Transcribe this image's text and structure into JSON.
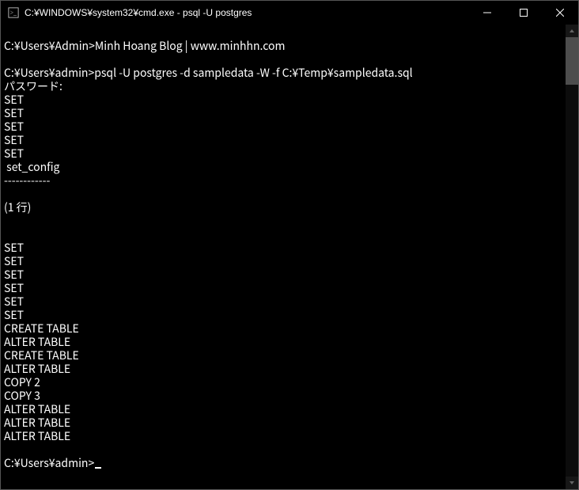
{
  "titlebar": {
    "icon_name": "cmd-icon",
    "text": "C:¥WINDOWS¥system32¥cmd.exe - psql  -U postgres"
  },
  "terminal": {
    "lines": [
      "",
      "C:¥Users¥Admin>Minh Hoang Blog | www.minhhn.com",
      "",
      "C:¥Users¥admin>psql -U postgres -d sampledata -W -f C:¥Temp¥sampledata.sql",
      "パスワード:",
      "SET",
      "SET",
      "SET",
      "SET",
      "SET",
      " set_config",
      "------------",
      "",
      "(1 行)",
      "",
      "",
      "SET",
      "SET",
      "SET",
      "SET",
      "SET",
      "SET",
      "CREATE TABLE",
      "ALTER TABLE",
      "CREATE TABLE",
      "ALTER TABLE",
      "COPY 2",
      "COPY 3",
      "ALTER TABLE",
      "ALTER TABLE",
      "ALTER TABLE",
      ""
    ],
    "final_prompt": "C:¥Users¥admin>"
  }
}
